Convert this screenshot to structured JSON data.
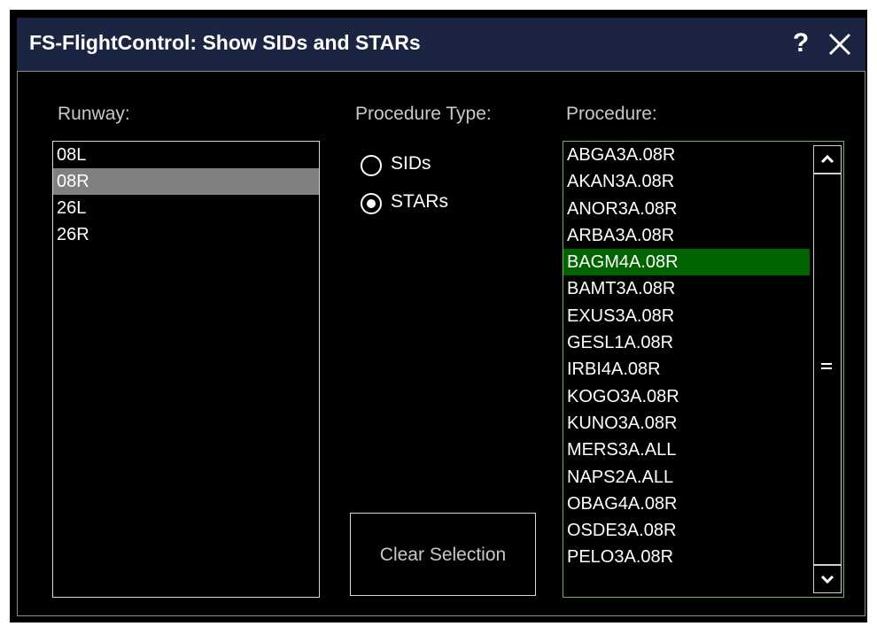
{
  "window": {
    "title": "FS-FlightControl: Show SIDs and STARs",
    "help_label": "?"
  },
  "runway": {
    "label": "Runway:",
    "items": [
      "08L",
      "08R",
      "26L",
      "26R"
    ],
    "selected": "08R"
  },
  "procedure_type": {
    "label": "Procedure Type:",
    "options": [
      "SIDs",
      "STARs"
    ],
    "selected": "STARs"
  },
  "clear_button": {
    "label": "Clear Selection"
  },
  "procedure": {
    "label": "Procedure:",
    "items": [
      "ABGA3A.08R",
      "AKAN3A.08R",
      "ANOR3A.08R",
      "ARBA3A.08R",
      "BAGM4A.08R",
      "BAMT3A.08R",
      "EXUS3A.08R",
      "GESL1A.08R",
      "IRBI4A.08R",
      "KOGO3A.08R",
      "KUNO3A.08R",
      "MERS3A.ALL",
      "NAPS2A.ALL",
      "OBAG4A.08R",
      "OSDE3A.08R",
      "PELO3A.08R"
    ],
    "selected": "BAGM4A.08R"
  },
  "colors": {
    "title_bar": "#1b2440",
    "selection_green": "#006400",
    "selection_gray": "#808080",
    "list_border_green": "#6db56d"
  }
}
